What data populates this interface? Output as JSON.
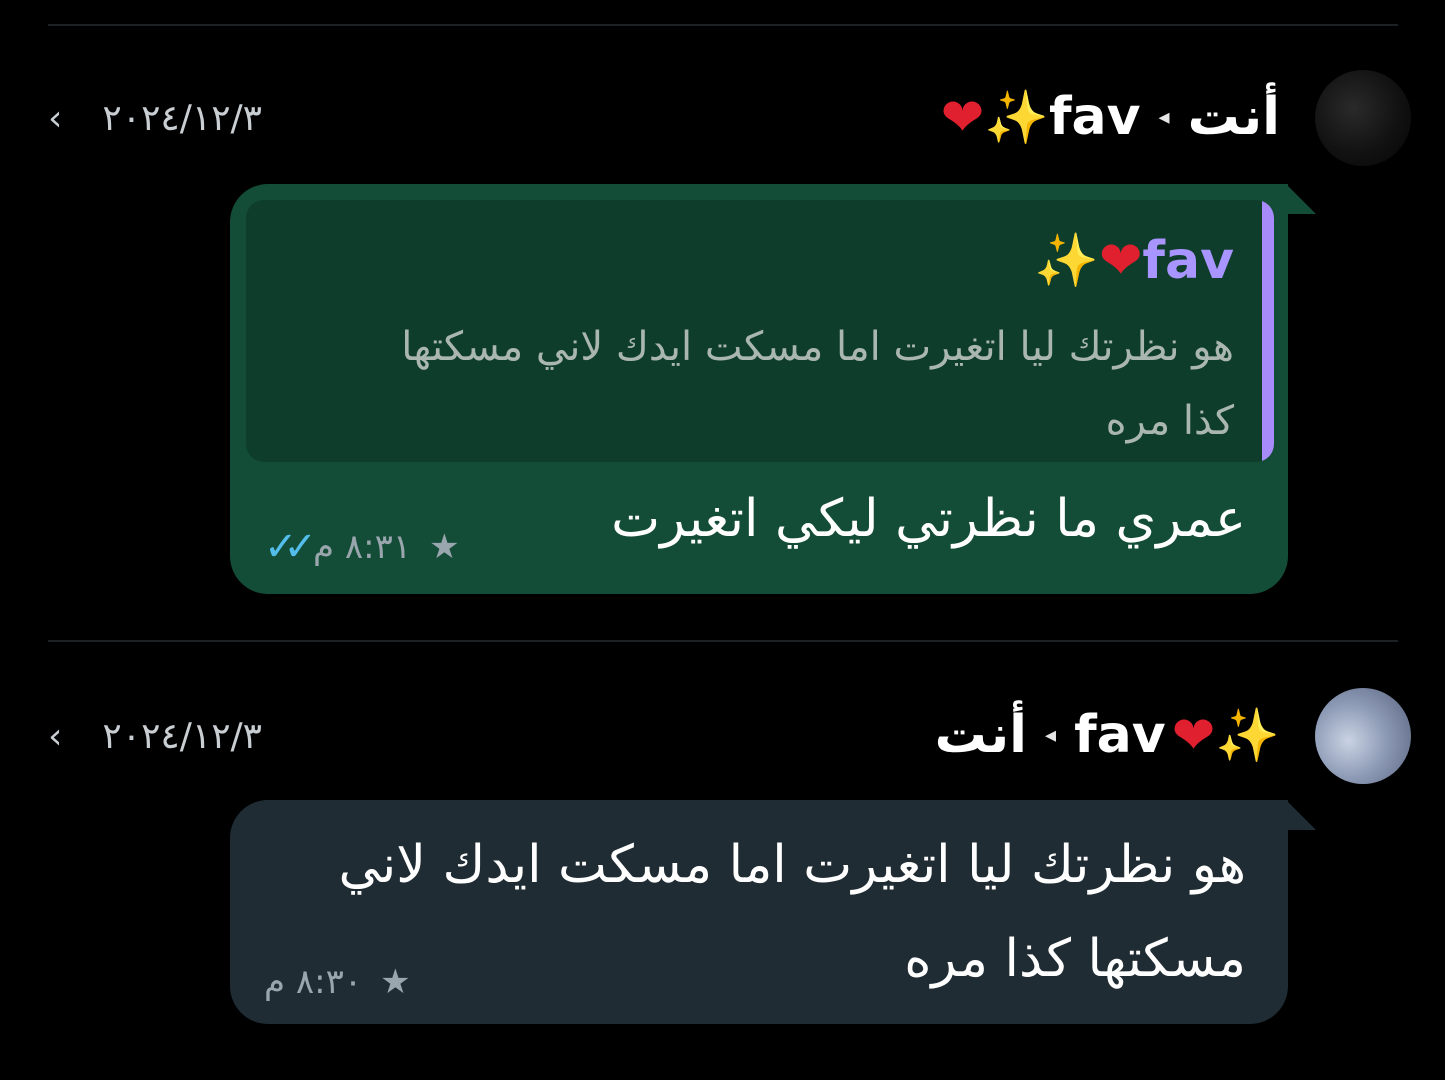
{
  "colors": {
    "background": "#000000",
    "sent_bubble": "#144d37",
    "received_bubble": "#202c33",
    "quote_bar": "#a78bfa",
    "read_ticks": "#53bdeb"
  },
  "messages": [
    {
      "avatar_icon": "avatar-dark-photo",
      "sender": "أنت",
      "recipient": "fav",
      "recipient_emoji": "❤️✨",
      "date": "٢٠٢٤/١٢/٣",
      "quote": {
        "name": "fav",
        "name_emoji": "❤️✨",
        "text": "هو نظرتك ليا اتغيرت اما مسكت ايدك لاني مسكتها كذا مره"
      },
      "text": "عمري ما نظرتي ليكي اتغيرت",
      "time": "٨:٣١ م",
      "starred": true,
      "status_icon": "double-check-read-icon"
    },
    {
      "avatar_icon": "avatar-sky-photo",
      "sender": "fav",
      "sender_emoji": "❤️✨",
      "recipient": "أنت",
      "date": "٢٠٢٤/١٢/٣",
      "text": "هو نظرتك ليا اتغيرت اما مسكت ايدك لاني مسكتها كذا مره",
      "time": "٨:٣٠ م",
      "starred": true
    }
  ]
}
